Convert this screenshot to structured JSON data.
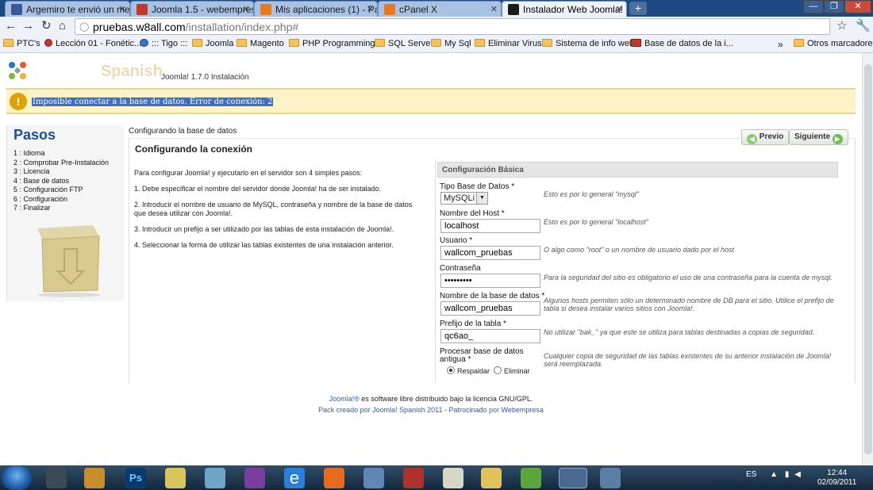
{
  "browser": {
    "tabs": [
      {
        "label": "Argemiro te envió un mens",
        "color": "#3b5998"
      },
      {
        "label": "Joomla 1.5 - webempresa.jc",
        "color": "#c0392b"
      },
      {
        "label": "Mis aplicaciones (1) - Packs",
        "color": "#e87a1e"
      },
      {
        "label": "cPanel X",
        "color": "#e87a1e"
      },
      {
        "label": "Instalador Web Joomla!",
        "color": "#1a1a1a"
      }
    ],
    "url_host": "pruebas.w8all.com",
    "url_path": "/installation/index.php#",
    "bookmarks": [
      "PTC's",
      "Lección 01 - Fonétic...",
      "::: Tigo :::",
      "Joomla",
      "Magento",
      "PHP Programming",
      "SQL Server",
      "My Sql",
      "Eliminar Virus",
      "Sistema de info web",
      "Base de datos de la i...",
      "Otros marcadores"
    ],
    "more": "»"
  },
  "page": {
    "spanish": "Spanish",
    "version": "Joomla! 1.7.0 Instalación",
    "error": "Imposible conectar a la base de datos. Error de conexión: 2",
    "pasos_title": "Pasos",
    "steps": [
      "1 : Idioma",
      "2 : Comprobar Pre-Instalación",
      "3 : Licencia",
      "4 : Base de datos",
      "5 : Configuración FTP",
      "6 : Configuración",
      "7 : Finalizar"
    ],
    "section_small": "Configurando la base de datos",
    "section_title": "Configurando la conexión",
    "prev": "Previo",
    "next": "Siguiente",
    "intro": [
      "Para configurar Joomla! y ejecutarlo en el servidor son 4 simples pasos:",
      "1. Debe especificar el nombre del servidor donde Joomla! ha de ser instalado.",
      "2. Introducir el nombre de usuario de MySQL, contraseña y nombre de la base de datos que desea utilizar con Joomla!.",
      "3. Introducir un prefijo a ser utilizado por las tablas de esta instalación de Joomla!.",
      "4. Seleccionar la forma de utilizar las tablas existentes de una instalación anterior."
    ],
    "config_title": "Configuración Básica",
    "fields": {
      "db_type": {
        "label": "Tipo Base de Datos *",
        "value": "MySQLi",
        "hint": "Esto es por lo general \"mysql\""
      },
      "host": {
        "label": "Nombre del Host *",
        "value": "localhost",
        "hint": "Esto es por lo general \"localhost\""
      },
      "user": {
        "label": "Usuario *",
        "value": "wallcom_pruebas",
        "hint": "O algo como \"root\" o un nombre de usuario dado por el host"
      },
      "password": {
        "label": "Contraseña",
        "value": "•••••••••",
        "hint": "Para la seguridad del sitio es obligatorio el uso de una contraseña para la cuenta de mysql."
      },
      "db_name": {
        "label": "Nombre de la base de datos *",
        "value": "wallcom_pruebas",
        "hint": "Algunos hosts permiten sólo un determinado nombre de DB para el sitio. Utilice el prefijo de tabla si desea instalar varios sitios con Joomla!."
      },
      "prefix": {
        "label": "Prefijo de la tabla *",
        "value": "qc6ao_",
        "hint": "No utilizar \"bak_\" ya que este se utiliza para tablas destinadas a copias de seguridad."
      },
      "old_db": {
        "label1": "Procesar base de datos",
        "label2": "antigua *",
        "opt1": "Respaldar",
        "opt2": "Eliminar",
        "hint": "Cualquier copia de seguridad de las tablas existentes de su anterior instalación de Joomla! será reemplazada."
      }
    },
    "footer1_link": "Joomla!®",
    "footer1_text": " es software libre distribuido bajo la licencia GNU/GPL.",
    "footer2": "Pack creado por Joomla! Spanish 2011 - Patrocinado por Webempresa"
  },
  "taskbar": {
    "lang": "ES",
    "time": "12:44",
    "date": "02/09/2011"
  }
}
